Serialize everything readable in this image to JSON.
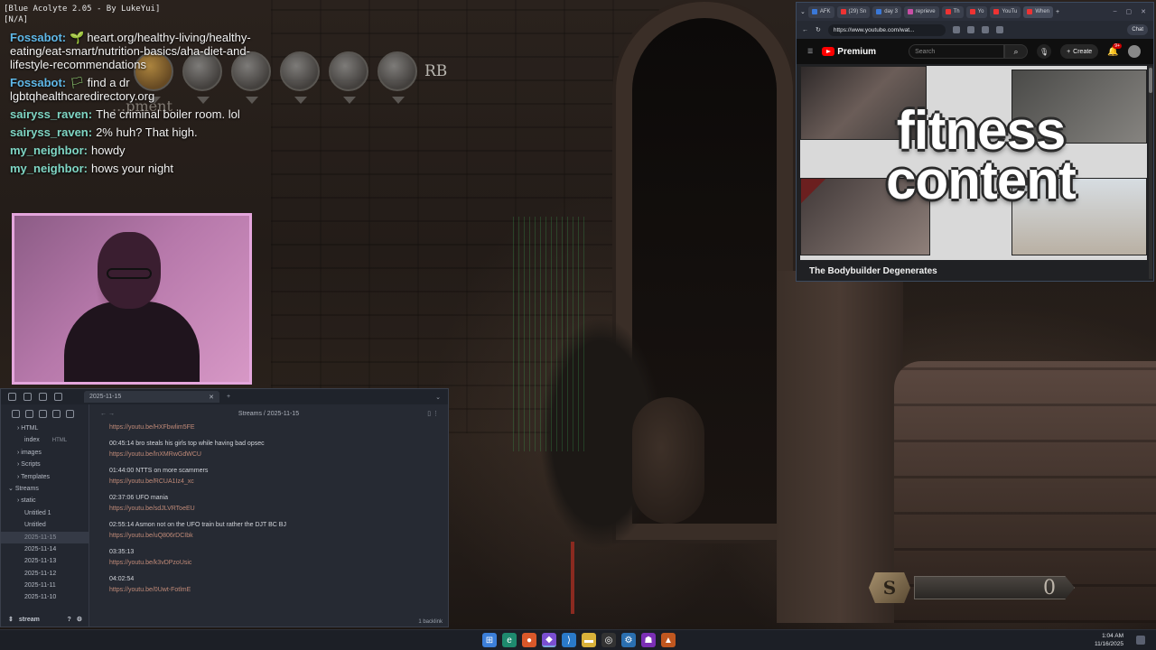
{
  "overlay": {
    "mod_title": "[Blue Acolyte 2.05 - By LukeYui]",
    "mod_sub": "[N/A]",
    "hud_button": "RB",
    "hud_partial_label": "...pment"
  },
  "chat": {
    "messages": [
      {
        "user": "Fossabot:",
        "icon": "🌱",
        "text": "heart.org/healthy-living/healthy-eating/eat-smart/nutrition-basics/aha-diet-and-lifestyle-recommendations",
        "user_color": "blue"
      },
      {
        "user": "Fossabot:",
        "icon": "🏳",
        "text": "find a dr lgbtqhealthcaredirectory.org",
        "user_color": "blue"
      },
      {
        "user": "sairyss_raven:",
        "icon": "",
        "text": "The criminal boiler room. lol",
        "user_color": "teal"
      },
      {
        "user": "sairyss_raven:",
        "icon": "",
        "text": "2% huh? That high.",
        "user_color": "teal"
      },
      {
        "user": "my_neighbor:",
        "icon": "",
        "text": "howdy",
        "user_color": "teal"
      },
      {
        "user": "my_neighbor:",
        "icon": "",
        "text": "hows your night",
        "user_color": "teal"
      }
    ]
  },
  "notes": {
    "tab_label": "2025-11-15",
    "breadcrumb": "Streams / 2025-11-15",
    "sidebar": [
      {
        "label": "HTML",
        "type": "folder"
      },
      {
        "label": "index",
        "badge": "HTML",
        "type": "child"
      },
      {
        "label": "images",
        "type": "folder"
      },
      {
        "label": "Scripts",
        "type": "folder"
      },
      {
        "label": "Templates",
        "type": "folder"
      },
      {
        "label": "Streams",
        "type": "top"
      },
      {
        "label": "static",
        "type": "folder"
      },
      {
        "label": "Untitled 1",
        "type": "child"
      },
      {
        "label": "Untitled",
        "type": "child"
      },
      {
        "label": "2025-11-15",
        "type": "child",
        "active": true
      },
      {
        "label": "2025-11-14",
        "type": "child"
      },
      {
        "label": "2025-11-13",
        "type": "child"
      },
      {
        "label": "2025-11-12",
        "type": "child"
      },
      {
        "label": "2025-11-11",
        "type": "child"
      },
      {
        "label": "2025-11-10",
        "type": "child"
      }
    ],
    "vault_name": "stream",
    "entries": [
      {
        "title": "",
        "link": "https://youtu.be/HXFbwlim5FE"
      },
      {
        "title": "00:45:14 bro steals his girls top while having bad opsec",
        "link": "https://youtu.be/lnXMRwGdWCU"
      },
      {
        "title": "01:44:00 NTTS on more scammers",
        "link": "https://youtu.be/RCUA1Iz4_xc"
      },
      {
        "title": "02:37:06 UFO mania",
        "link": "https://youtu.be/sdJLVRToeEU"
      },
      {
        "title": "02:55:14 Asmon not on the UFO train but rather the DJT BC BJ",
        "link": "https://youtu.be/uQ806rDCIbk"
      },
      {
        "title": "03:35:13",
        "link": "https://youtu.be/k3vDPzoUsic"
      },
      {
        "title": "04:02:54",
        "link": "https://youtu.be/0Uwt-FotlmE"
      }
    ],
    "status": "1 backlink"
  },
  "browser": {
    "tabs": [
      "AFK",
      "(29) Sn",
      "day 3",
      "reprieve",
      "Th",
      "Yo",
      "YouTu",
      "When"
    ],
    "url": "https://www.youtube.com/wat...",
    "chat_label": "Chat",
    "yt_brand": "Premium",
    "search_placeholder": "Search",
    "create_label": "Create",
    "notif_count": "9+",
    "video_overlay_line1": "fitness",
    "video_overlay_line2": "content",
    "video_title": "The Bodybuilder Degenerates"
  },
  "souls": {
    "icon_glyph": "S",
    "count": "0"
  },
  "taskbar": {
    "time": "1:04 AM",
    "date": "11/16/2025"
  }
}
